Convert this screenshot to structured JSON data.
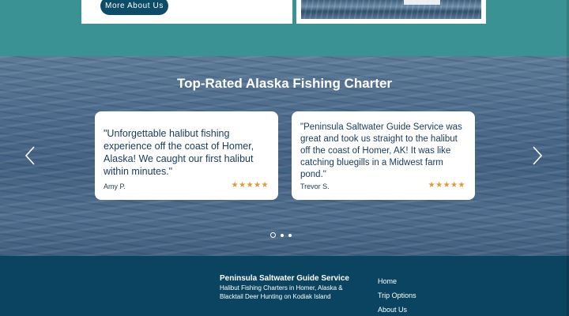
{
  "top": {
    "more_about_label": "More About Us"
  },
  "testimonials": {
    "title": "Top-Rated Alaska Fishing Charter",
    "reviews": [
      {
        "text": "\"Unforgettable halibut fishing experience off the coast of Homer, Alaska! We caught our first halibut within minutes.\"",
        "author": "Amy P.",
        "stars": "★★★★★"
      },
      {
        "text": "\"Peninsula Saltwater Guide Service was great and took us straight to the halibut off the coast of Homer, AK! It was like catching bluegills in a Midwest farm pond.\"",
        "author": "Trevor S.",
        "stars": "★★★★★"
      }
    ],
    "slides": {
      "count": 3,
      "active": 1
    },
    "colors": {
      "star": "#d89a3a",
      "card_text": "#173a5e"
    },
    "icons": {
      "prev": "chevron-left-icon",
      "next": "chevron-right-icon"
    }
  },
  "footer": {
    "brand": "Peninsula Saltwater Guide Service",
    "tagline": "Halibut Fishing Charters in Homer, Alaska & Blacktail Deer Hunting on Kodiak Island",
    "nav": [
      "Home",
      "Trip Options",
      "About Us"
    ]
  },
  "theme": {
    "teal": "#3a9295",
    "navy": "#0b4461",
    "button": "#0d4c66"
  }
}
